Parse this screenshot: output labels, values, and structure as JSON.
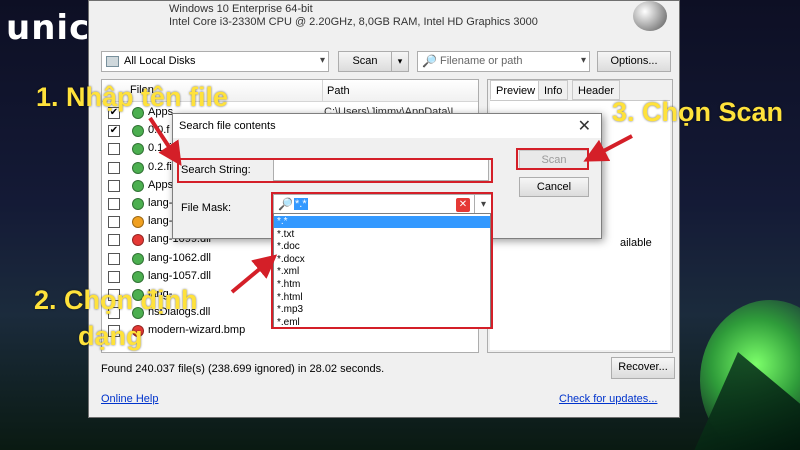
{
  "logo": {
    "text": "unica"
  },
  "window": {
    "os": "Windows 10 Enterprise 64-bit",
    "cpu": "Intel Core i3-2330M CPU @ 2.20GHz, 8,0GB RAM, Intel HD Graphics 3000"
  },
  "toolbar": {
    "disk_label": "All Local Disks",
    "scan_label": "Scan",
    "search_placeholder": "Filename or path",
    "options_label": "Options..."
  },
  "file_list": {
    "col_file": "Filen",
    "col_path": "Path",
    "rows": [
      {
        "checked": true,
        "status": "green",
        "name": "Apps",
        "path": "C:\\Users\\Jimmy\\AppData\\L"
      },
      {
        "checked": true,
        "status": "green",
        "name": "0.0.f",
        "path": ""
      },
      {
        "checked": false,
        "status": "green",
        "name": "0.1.fi",
        "path": ""
      },
      {
        "checked": false,
        "status": "green",
        "name": "0.2.fi",
        "path": ""
      },
      {
        "checked": false,
        "status": "green",
        "name": "Apps",
        "path": ""
      },
      {
        "checked": false,
        "status": "green",
        "name": "lang-",
        "path": ""
      },
      {
        "checked": false,
        "status": "orange",
        "name": "lang-",
        "path": ""
      },
      {
        "checked": false,
        "status": "red",
        "name": "lang-1099.dll",
        "path": ""
      },
      {
        "checked": false,
        "status": "green",
        "name": "lang-1062.dll",
        "path": ""
      },
      {
        "checked": false,
        "status": "green",
        "name": "lang-1057.dll",
        "path": ""
      },
      {
        "checked": false,
        "status": "green",
        "name": "lang-",
        "path": ""
      },
      {
        "checked": false,
        "status": "green",
        "name": "nsDialogs.dll",
        "path": ""
      },
      {
        "checked": false,
        "status": "red",
        "name": "modern-wizard.bmp",
        "path": ""
      }
    ]
  },
  "right_panel": {
    "tabs": [
      "Preview",
      "Info",
      "Header"
    ],
    "partial_text": "ailable"
  },
  "status_text": "Found 240.037 file(s) (238.699 ignored) in 28.02 seconds.",
  "recover_label": "Recover...",
  "footer": {
    "online_help": "Online Help",
    "check_updates": "Check for updates..."
  },
  "dialog": {
    "title": "Search file contents",
    "close": "✕",
    "search_label": "Search String:",
    "search_value": "",
    "mask_label": "File Mask:",
    "mask_value": "*.*",
    "scan_label": "Scan",
    "cancel_label": "Cancel",
    "mask_options": [
      "*.*",
      "*.txt",
      "*.doc",
      "*.docx",
      "*.xml",
      "*.htm",
      "*.html",
      "*.mp3",
      "*.eml"
    ]
  },
  "annotations": {
    "step1": "1. Nhập tên file",
    "step2_line1": "2. Chọn định",
    "step2_line2": "dạng",
    "step3": "3. Chọn Scan"
  },
  "colors": {
    "annotation": "#ffe23b",
    "highlight": "#d41f28",
    "selection": "#3399ff"
  }
}
